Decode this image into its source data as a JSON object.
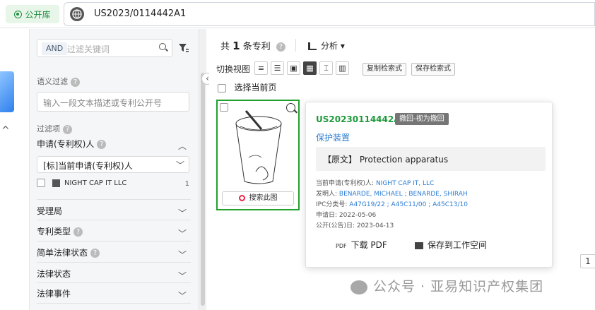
{
  "topbar": {
    "public_lib": "公开库",
    "search_value": "US2023/0114442A1"
  },
  "filter": {
    "and_label": "AND",
    "keyword_placeholder": "过滤关键词",
    "semantic_title": "语义过滤",
    "semantic_placeholder": "输入一段文本描述或专利公开号",
    "items_title": "过滤项",
    "applicant_title": "申请(专利权)人",
    "applicant_select": "[标]当前申请(专利权)人",
    "option_name": "NIGHT CAP IT LLC",
    "option_count": "1",
    "sections": [
      "受理局",
      "专利类型",
      "简单法律状态",
      "法律状态",
      "法律事件"
    ]
  },
  "main": {
    "count_prefix": "共",
    "count_num": "1",
    "count_suffix": "条专利",
    "analyze": "分析",
    "view_label": "切换视图",
    "copy_btn": "复制检索式",
    "save_btn": "保存检索式",
    "select_page": "选择当前页",
    "search_image": "搜索此图",
    "pager_value": "1"
  },
  "popup": {
    "number": "US20230114442A1",
    "status": "撤回-视为撤回",
    "title": "保护装置",
    "orig_prefix": "【原文】",
    "orig_text": "Protection apparatus",
    "assignee_label": "当前申请(专利权)人:",
    "assignee": "NIGHT CAP IT, LLC",
    "inventor_label": "发明人:",
    "inventors": "BENARDE, MICHAEL ;  BENARDE, SHIRAH",
    "ipc_label": "IPC分类号:",
    "ipc": "A47G19/22 ;  A45C11/00 ;  A45C13/10",
    "app_date_label": "申请日:",
    "app_date": "2022-05-06",
    "pub_date_label": "公开(公告)日:",
    "pub_date": "2023-04-13",
    "pdf_tag": "PDF",
    "download": "下载 PDF",
    "save_ws": "保存到工作空间"
  },
  "watermark": "公众号 · 亚易知识产权集团",
  "colors": {
    "accent_green": "#22a12f",
    "link_blue": "#2b7cd3",
    "status_gray": "#757575"
  }
}
